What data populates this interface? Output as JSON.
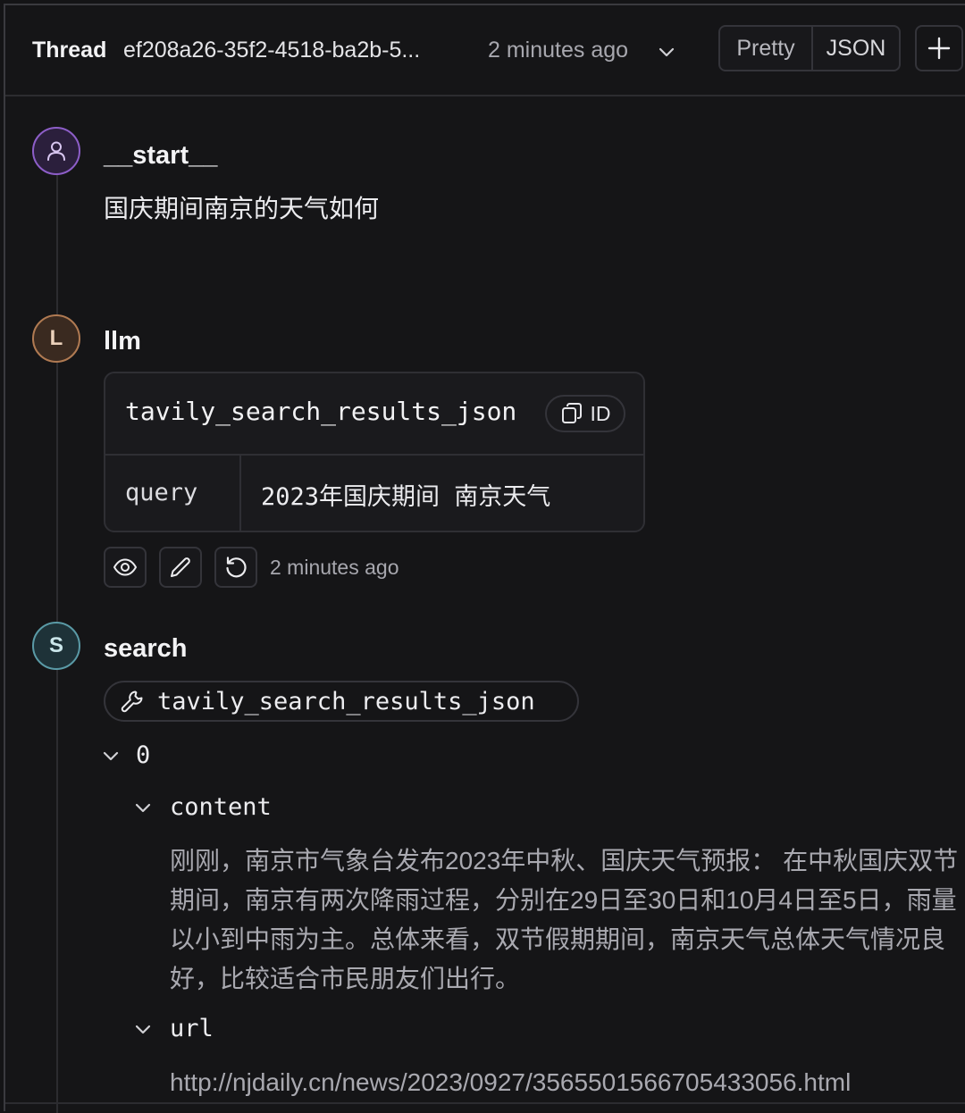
{
  "header": {
    "thread_label": "Thread",
    "thread_id": "ef208a26-35f2-4518-ba2b-5...",
    "time": "2 minutes ago",
    "view_modes": [
      "Pretty",
      "JSON"
    ]
  },
  "nodes": {
    "start": {
      "avatar_icon": "user-icon",
      "title": "__start__",
      "message": "国庆期间南京的天气如何"
    },
    "llm": {
      "avatar_letter": "L",
      "title": "llm",
      "tool_call": {
        "name": "tavily_search_results_json",
        "id_label": "ID",
        "args": [
          {
            "key": "query",
            "value": "2023年国庆期间 南京天气"
          }
        ]
      },
      "actions": [
        "eye-icon",
        "pencil-icon",
        "rotate-icon"
      ],
      "time": "2 minutes ago"
    },
    "search": {
      "avatar_letter": "S",
      "title": "search",
      "tool_name": "tavily_search_results_json",
      "result": {
        "index": "0",
        "content_key": "content",
        "content": "刚刚，南京市气象台发布2023年中秋、国庆天气预报： 在中秋国庆双节期间，南京有两次降雨过程，分别在29日至30日和10月4日至5日，雨量以小到中雨为主。总体来看，双节假期期间，南京天气总体天气情况良好，比较适合市民朋友们出行。",
        "url_key": "url",
        "url": "http://njdaily.cn/news/2023/0927/3565501566705433056.html"
      }
    }
  },
  "colors": {
    "background": "#141416",
    "start_accent": "#8d5ec8",
    "llm_accent": "#b07a52",
    "search_accent": "#5a9aa6"
  }
}
